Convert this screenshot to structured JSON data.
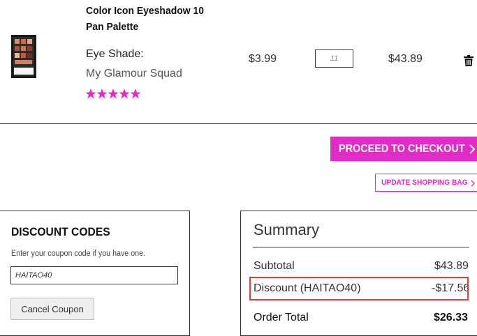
{
  "cart": {
    "item": {
      "name": "Color Icon Eyeshadow 10 Pan Palette",
      "attribute_label": "Eye Shade:",
      "attribute_value": "My Glamour Squad",
      "rating_stars": 5,
      "unit_price": "$3.99",
      "quantity": "11",
      "line_total": "$43.89",
      "delete_icon": "trash-icon"
    }
  },
  "actions": {
    "checkout_label": "PROCEED TO CHECKOUT",
    "update_label": "UPDATE SHOPPING BAG"
  },
  "discount": {
    "title": "DISCOUNT CODES",
    "hint": "Enter your coupon code if you have one.",
    "coupon_value": "HAITAO40",
    "cancel_label": "Cancel Coupon"
  },
  "summary": {
    "title": "Summary",
    "subtotal_label": "Subtotal",
    "subtotal_value": "$43.89",
    "discount_label": "Discount (HAITAO40)",
    "discount_value": "-$17.56",
    "total_label": "Order Total",
    "total_value": "$26.33"
  },
  "colors": {
    "brand_accent": "#e32bc5",
    "highlight_box": "#d9413b"
  }
}
